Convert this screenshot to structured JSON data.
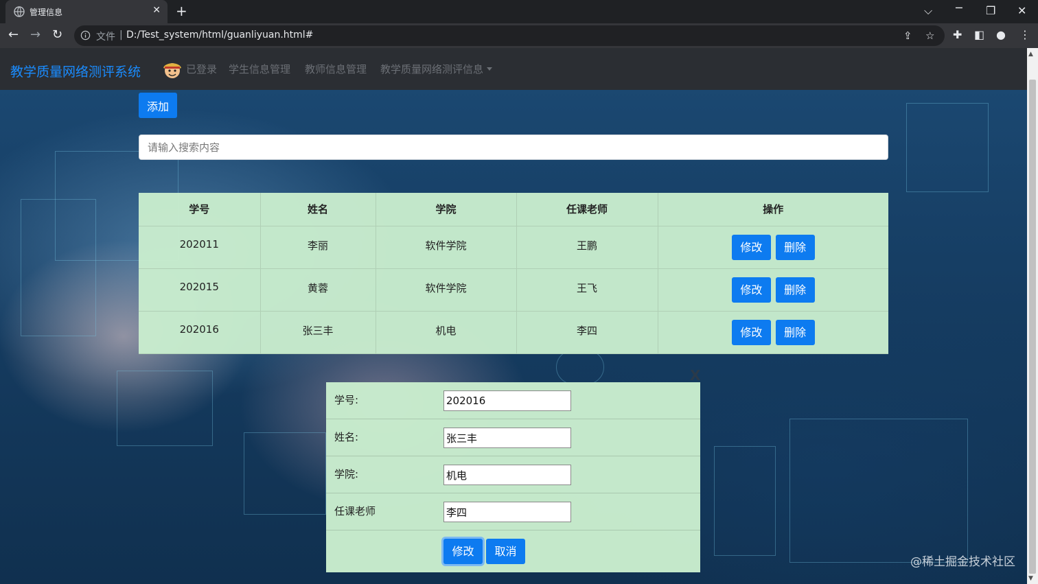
{
  "browser": {
    "tab_title": "管理信息",
    "tab_close": "✕",
    "new_tab": "+",
    "address_label": "文件",
    "address_separator": "|",
    "url": "D:/Test_system/html/guanliyuan.html#"
  },
  "navbar": {
    "brand": "教学质量网络测评系统",
    "logged_in": "已登录",
    "items": [
      "学生信息管理",
      "教师信息管理",
      "教学质量网络测评信息"
    ]
  },
  "toolbar": {
    "add_label": "添加",
    "search_placeholder": "请输入搜索内容"
  },
  "table": {
    "headers": [
      "学号",
      "姓名",
      "学院",
      "任课老师",
      "操作"
    ],
    "rows": [
      {
        "id": "202011",
        "name": "李丽",
        "college": "软件学院",
        "teacher": "王鹏"
      },
      {
        "id": "202015",
        "name": "黄蓉",
        "college": "软件学院",
        "teacher": "王飞"
      },
      {
        "id": "202016",
        "name": "张三丰",
        "college": "机电",
        "teacher": "李四"
      }
    ],
    "edit_label": "修改",
    "delete_label": "删除"
  },
  "modal": {
    "close_label": "X",
    "fields": [
      {
        "label": "学号:",
        "value": "202016"
      },
      {
        "label": "姓名:",
        "value": "张三丰"
      },
      {
        "label": "学院:",
        "value": "机电"
      },
      {
        "label": "任课老师",
        "value": "李四"
      }
    ],
    "submit_label": "修改",
    "cancel_label": "取消"
  },
  "watermark": "@稀土掘金技术社区",
  "colors": {
    "primary": "#0d7bf0",
    "brand": "#1a8cff",
    "navbar_bg": "#2b2e33",
    "table_bg": "#c8eccd"
  }
}
